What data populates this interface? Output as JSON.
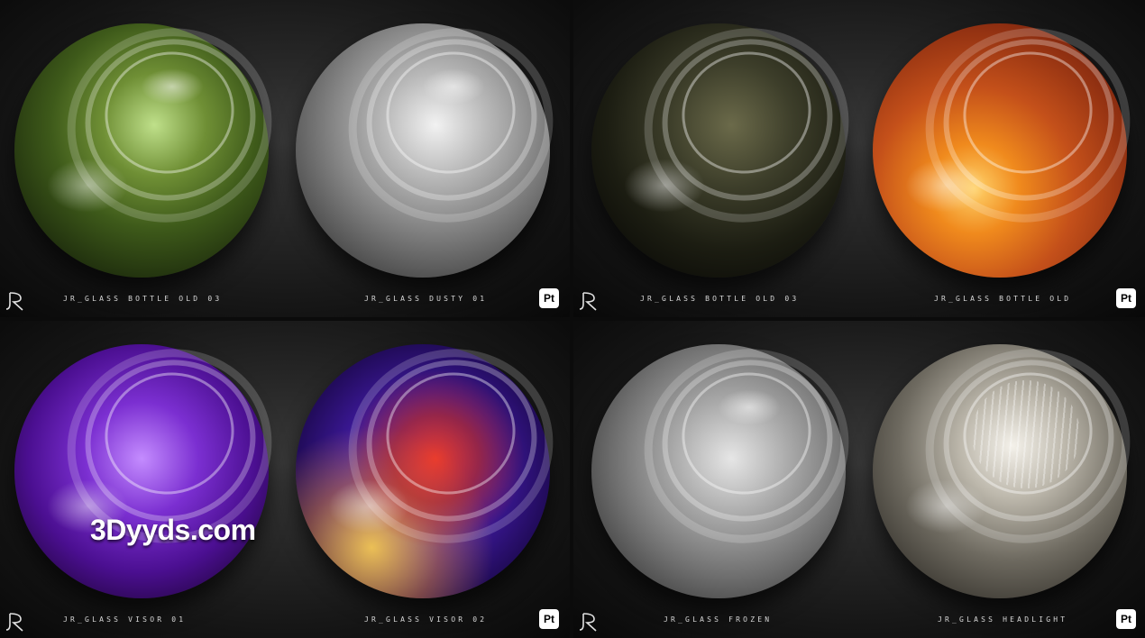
{
  "panels": [
    {
      "left_label": "JR_GLASS BOTTLE OLD 03",
      "right_label": "JR_GLASS DUSTY 01",
      "badge": "Pt"
    },
    {
      "left_label": "JR_GLASS BOTTLE OLD 03",
      "right_label": "JR_GLASS BOTTLE OLD",
      "badge": "Pt"
    },
    {
      "left_label": "JR_GLASS VISOR 01",
      "right_label": "JR_GLASS VISOR 02",
      "badge": "Pt"
    },
    {
      "left_label": "JR_GLASS FROZEN",
      "right_label": "JR_GLASS HEADLIGHT",
      "badge": "Pt"
    }
  ],
  "watermark": "3Dyyds.com",
  "colors": {
    "background": "#0b0b0b",
    "label_text": "#d8d8d8",
    "badge_bg": "#ffffff"
  },
  "icons": [
    "jr-logo-icon",
    "painter-pt-icon"
  ]
}
